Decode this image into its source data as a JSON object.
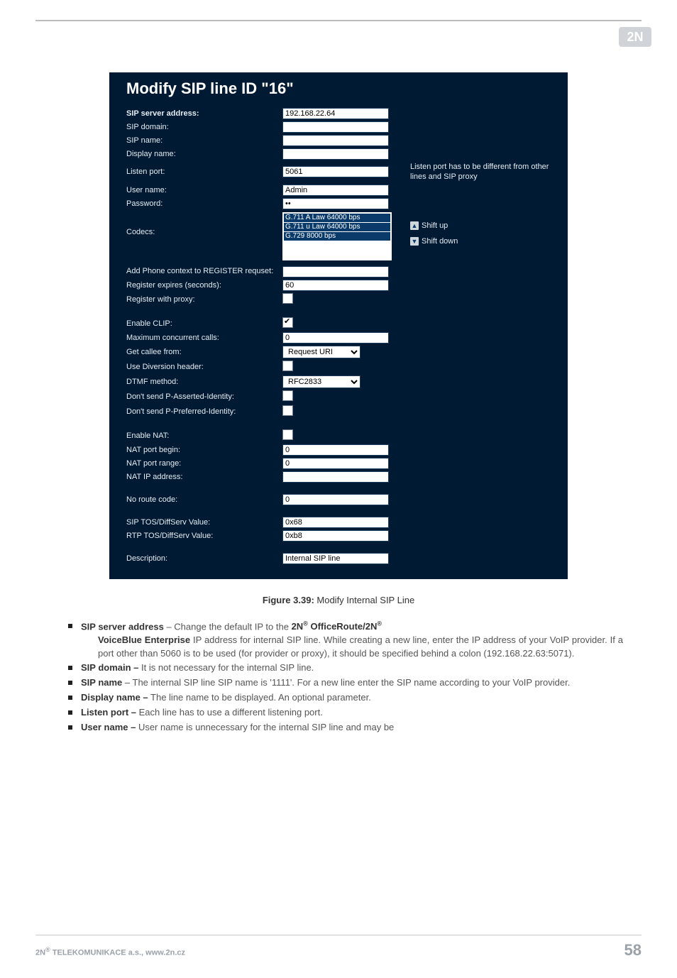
{
  "logo_alt": "2N",
  "panel": {
    "title": "Modify SIP line ID \"16\"",
    "sip_server_address": {
      "label": "SIP server address:",
      "value": "192.168.22.64"
    },
    "sip_domain": {
      "label": "SIP domain:",
      "value": ""
    },
    "sip_name": {
      "label": "SIP name:",
      "value": ""
    },
    "display_name": {
      "label": "Display name:",
      "value": ""
    },
    "listen_port": {
      "label": "Listen port:",
      "value": "5061",
      "hint": "Listen port has to be different from other lines and SIP proxy"
    },
    "user_name": {
      "label": "User name:",
      "value": "Admin"
    },
    "password": {
      "label": "Password:",
      "value": "••"
    },
    "codecs": {
      "label": "Codecs:",
      "options": [
        "G.711 A Law 64000 bps",
        "G.711 u Law 64000 bps",
        "G.729 8000 bps"
      ],
      "shift_up": "Shift up",
      "shift_down": "Shift down"
    },
    "add_phone_context": {
      "label": "Add Phone context to REGISTER requset:",
      "value": ""
    },
    "register_expires": {
      "label": "Register expires (seconds):",
      "value": "60"
    },
    "register_with_proxy": {
      "label": "Register with proxy:",
      "checked": false
    },
    "enable_clip": {
      "label": "Enable CLIP:",
      "checked": true
    },
    "max_concurrent_calls": {
      "label": "Maximum concurrent calls:",
      "value": "0"
    },
    "get_callee_from": {
      "label": "Get callee from:",
      "value": "Request URI"
    },
    "use_diversion_header": {
      "label": "Use Diversion header:",
      "checked": false
    },
    "dtmf_method": {
      "label": "DTMF method:",
      "value": "RFC2833"
    },
    "no_p_asserted": {
      "label": "Don't send P-Asserted-Identity:",
      "checked": false
    },
    "no_p_preferred": {
      "label": "Don't send P-Preferred-Identity:",
      "checked": false
    },
    "enable_nat": {
      "label": "Enable NAT:",
      "checked": false
    },
    "nat_port_begin": {
      "label": "NAT port begin:",
      "value": "0"
    },
    "nat_port_range": {
      "label": "NAT port range:",
      "value": "0"
    },
    "nat_ip_address": {
      "label": "NAT IP address:",
      "value": ""
    },
    "no_route_code": {
      "label": "No route code:",
      "value": "0"
    },
    "sip_tos": {
      "label": "SIP TOS/DiffServ Value:",
      "value": "0x68"
    },
    "rtp_tos": {
      "label": "RTP TOS/DiffServ Value:",
      "value": "0xb8"
    },
    "description": {
      "label": "Description:",
      "value": "Internal SIP line"
    }
  },
  "caption": {
    "prefix": "Figure 3.39:",
    "text": " Modify Internal SIP Line"
  },
  "bullets": {
    "b1": {
      "lead": "SIP server address",
      "text_a": " – Change the default IP to the ",
      "brand": "2N",
      "sup": "®",
      "brand2": " OfficeRoute/2N",
      "brand3": "VoiceBlue Enterprise",
      "text_b": " IP address for internal SIP line. While creating a new line, enter the IP address of your VoIP provider. If a port other than 5060 is to be used (for provider or proxy), it should be specified behind a colon (192.168.22.63:5071)."
    },
    "b2": {
      "lead": "SIP domain –",
      "text": " It is not necessary for the internal SIP line."
    },
    "b3": {
      "lead": "SIP name",
      "text": " – The internal SIP line SIP name is '1111'. For a new line enter the SIP name according to your VoIP provider."
    },
    "b4": {
      "lead": "Display name –",
      "text": " The line name to be displayed. An optional parameter."
    },
    "b5": {
      "lead": "Listen port –",
      "text": " Each line has to use a different listening port."
    },
    "b6": {
      "lead": "User name –",
      "text": " User name is unnecessary for the internal SIP line and may be"
    }
  },
  "footer": {
    "company_pre": "2N",
    "sup": "®",
    "company_post": " TELEKOMUNIKACE a.s., www.2n.cz",
    "page": "58"
  }
}
